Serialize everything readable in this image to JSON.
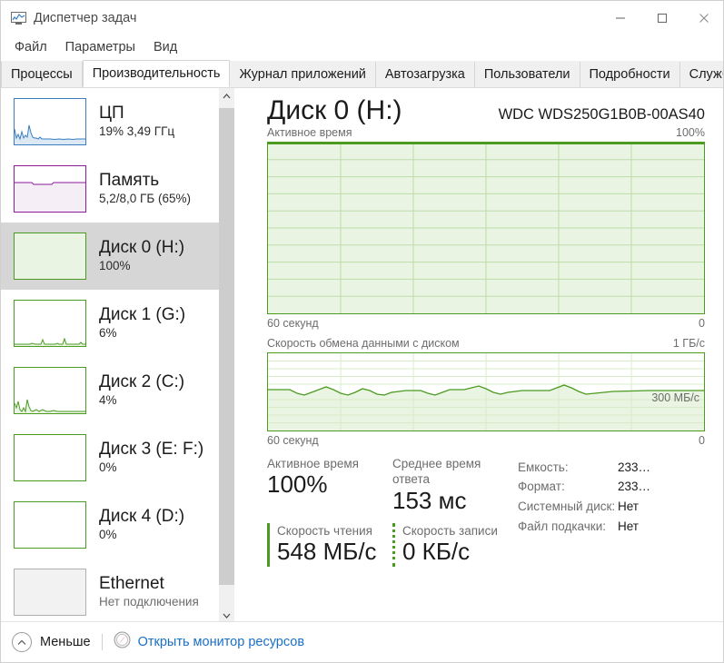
{
  "window": {
    "title": "Диспетчер задач",
    "icon": "task-manager-icon",
    "minimize_label": "—",
    "maximize_label": "□",
    "close_label": "✕"
  },
  "menubar": {
    "items": [
      {
        "label": "Файл"
      },
      {
        "label": "Параметры"
      },
      {
        "label": "Вид"
      }
    ]
  },
  "tabs": [
    {
      "label": "Процессы",
      "active": false
    },
    {
      "label": "Производительность",
      "active": true
    },
    {
      "label": "Журнал приложений",
      "active": false
    },
    {
      "label": "Автозагрузка",
      "active": false
    },
    {
      "label": "Пользователи",
      "active": false
    },
    {
      "label": "Подробности",
      "active": false
    },
    {
      "label": "Службы",
      "active": false
    }
  ],
  "sidebar": {
    "items": [
      {
        "title": "ЦП",
        "sub": "19%  3,49 ГГц",
        "color": "#3a7ebf",
        "fill": "#e8f1f8",
        "selected": false
      },
      {
        "title": "Память",
        "sub": "5,2/8,0 ГБ (65%)",
        "color": "#8c1a9b",
        "fill": "#f5eef6",
        "selected": false
      },
      {
        "title": "Диск 0 (H:)",
        "sub": "100%",
        "color": "#4a9b20",
        "fill": "#eaf4e2",
        "selected": true
      },
      {
        "title": "Диск 1 (G:)",
        "sub": "6%",
        "color": "#4a9b20",
        "fill": "#eaf4e2",
        "selected": false
      },
      {
        "title": "Диск 2 (C:)",
        "sub": "4%",
        "color": "#4a9b20",
        "fill": "#eaf4e2",
        "selected": false
      },
      {
        "title": "Диск 3 (E: F:)",
        "sub": "0%",
        "color": "#4a9b20",
        "fill": "#eaf4e2",
        "selected": false
      },
      {
        "title": "Диск 4 (D:)",
        "sub": "0%",
        "color": "#4a9b20",
        "fill": "#eaf4e2",
        "selected": false
      },
      {
        "title": "Ethernet",
        "sub": "Нет подключения",
        "color": "#b0b0b0",
        "fill": "#f2f2f2",
        "selected": false
      }
    ],
    "scrollbar": {
      "up_icon": "chevron-up-icon",
      "down_icon": "chevron-down-icon"
    }
  },
  "main": {
    "title": "Диск 0 (H:)",
    "model": "WDC WDS250G1B0B-00AS40",
    "chart_active": {
      "caption_left": "Активное время",
      "caption_right": "100%",
      "foot_left": "60 секунд",
      "foot_right": "0"
    },
    "chart_transfer": {
      "caption_left": "Скорость обмена данными с диском",
      "caption_right": "1 ГБ/с",
      "foot_left": "60 секунд",
      "foot_right": "0",
      "inline_label": "300 МБ/с"
    },
    "stats": {
      "active_time_label": "Активное время",
      "active_time_value": "100%",
      "avg_response_label": "Среднее время ответа",
      "avg_response_value": "153 мс",
      "read_label": "Скорость чтения",
      "read_value": "548 МБ/с",
      "write_label": "Скорость записи",
      "write_value": "0 КБ/с",
      "details": [
        {
          "key": "Емкость:",
          "value": "233…"
        },
        {
          "key": "Формат:",
          "value": "233…"
        },
        {
          "key": "Системный диск:",
          "value": "Нет"
        },
        {
          "key": "Файл подкачки:",
          "value": "Нет"
        }
      ]
    }
  },
  "statusbar": {
    "less_label": "Меньше",
    "less_icon": "chevron-up-circle-icon",
    "resmon_icon": "resource-monitor-icon",
    "resmon_label": "Открыть монитор ресурсов"
  },
  "colors": {
    "disk_accent": "#4a9b20",
    "disk_fill": "#eaf4e2",
    "cpu_accent": "#3a7ebf",
    "memory_accent": "#8c1a9b",
    "link": "#1a6fc4"
  },
  "chart_data": {
    "type": "area",
    "title": "Активное время",
    "ylim": [
      0,
      100
    ],
    "xlim": [
      60,
      0
    ],
    "ylabel": "100%",
    "xlabel": "60 секунд",
    "values": [
      100,
      100,
      100,
      100,
      100,
      100,
      100,
      100,
      100,
      100,
      100,
      100,
      100,
      100,
      100,
      100,
      100,
      100,
      100,
      100
    ],
    "second_chart": {
      "type": "line",
      "title": "Скорость обмена данными с диском",
      "ylim": [
        0,
        1024
      ],
      "ylabel": "1 ГБ/с",
      "xlabel": "60 секунд",
      "inline_marker": "300 МБ/с",
      "values": [
        545,
        548,
        520,
        548,
        560,
        530,
        555,
        525,
        548,
        548,
        530,
        548,
        560,
        525,
        548,
        548,
        548,
        575,
        530,
        548
      ]
    }
  }
}
